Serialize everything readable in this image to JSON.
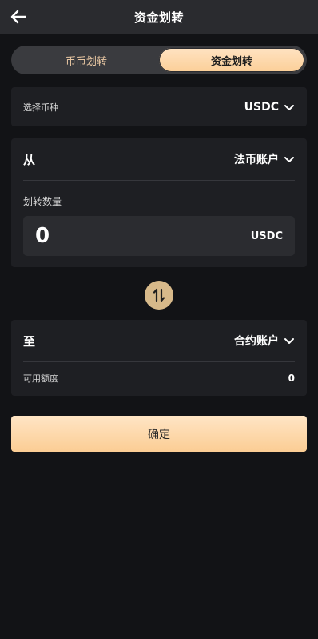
{
  "header": {
    "title": "资金划转",
    "back_icon": "arrow-left-icon"
  },
  "tabs": [
    {
      "label": "币币划转",
      "active": false
    },
    {
      "label": "资金划转",
      "active": true
    }
  ],
  "coin_select": {
    "label": "选择币种",
    "value": "USDC"
  },
  "from": {
    "label": "从",
    "account": "法币账户"
  },
  "amount": {
    "label": "划转数量",
    "value": "",
    "placeholder": "0",
    "unit": "USDC"
  },
  "swap": {
    "icon": "swap-vertical-icon"
  },
  "to": {
    "label": "至",
    "account": "合约账户"
  },
  "available": {
    "label": "可用额度",
    "value": "0"
  },
  "confirm": {
    "label": "确定"
  },
  "colors": {
    "accent": "#fbcf98",
    "background": "#121316",
    "card": "#1e1f23",
    "swap": "#d7b98a"
  }
}
